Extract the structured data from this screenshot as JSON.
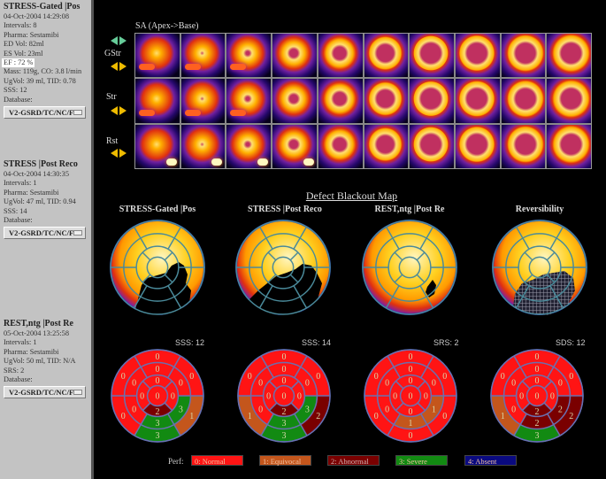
{
  "studies": [
    {
      "title": "STRESS-Gated |Pos",
      "lines": [
        "04-Oct-2004 14:29:08",
        "Intervals: 8",
        "Pharma: Sestamibi",
        "ED Vol:   82ml",
        "ES Vol:   23ml"
      ],
      "ef": "EF  : 72 %",
      "lines2": [
        "Mass: 119g, CO: 3.8 l/min",
        "UgVol:   39 ml,  TID: 0.78",
        "SSS: 12",
        "Database:"
      ],
      "database": "V2-GSRD/TC/NC/F"
    },
    {
      "title": "STRESS |Post Reco",
      "lines": [
        "04-Oct-2004 14:30:35",
        "Intervals: 1",
        "Pharma: Sestamibi",
        "UgVol:   47 ml,  TID: 0.94",
        "SSS: 14",
        "Database:"
      ],
      "database": "V2-GSRD/TC/NC/F"
    },
    {
      "title": "REST,ntg |Post Re",
      "lines": [
        "05-Oct-2004 13:25:58",
        "Intervals: 1",
        "Pharma: Sestamibi",
        "UgVol:   50 ml,  TID: N/A",
        "SRS: 2",
        "Database:"
      ],
      "database": "V2-GSRD/TC/NC/F"
    }
  ],
  "sa": {
    "title": "SA (Apex->Base)",
    "rows": [
      "GStr",
      "Str",
      "Rst"
    ]
  },
  "blackout": {
    "title": "Defect Blackout Map",
    "plots": [
      "STRESS-Gated |Pos",
      "STRESS |Post Reco",
      "REST,ntg |Post Re",
      "Reversibility"
    ]
  },
  "scores": [
    {
      "label": "SSS: 12",
      "apex": 0,
      "apical": [
        0,
        0,
        2,
        0
      ],
      "mid": [
        0,
        0,
        3,
        3,
        0,
        0
      ],
      "basal": [
        0,
        0,
        1,
        3,
        0,
        0
      ]
    },
    {
      "label": "SSS: 14",
      "apex": 0,
      "apical": [
        0,
        0,
        2,
        0
      ],
      "mid": [
        0,
        0,
        3,
        3,
        0,
        0
      ],
      "basal": [
        0,
        0,
        2,
        3,
        1,
        0
      ]
    },
    {
      "label": "SRS: 2",
      "apex": 0,
      "apical": [
        0,
        0,
        0,
        0
      ],
      "mid": [
        0,
        0,
        1,
        1,
        0,
        0
      ],
      "basal": [
        0,
        0,
        0,
        0,
        0,
        0
      ]
    },
    {
      "label": "SDS: 12",
      "apex": 0,
      "apical": [
        0,
        0,
        2,
        0
      ],
      "mid": [
        0,
        0,
        2,
        2,
        0,
        0
      ],
      "basal": [
        0,
        0,
        2,
        3,
        1,
        0
      ]
    }
  ],
  "legend": {
    "label": "Perf:",
    "items": [
      {
        "text": "0: Normal",
        "color": "#ff1414"
      },
      {
        "text": "1: Equivocal",
        "color": "#c4561c"
      },
      {
        "text": "2: Abnormal",
        "color": "#7a0000"
      },
      {
        "text": "3: Severe",
        "color": "#128a12"
      },
      {
        "text": "4: Absent",
        "color": "#0a0a80"
      }
    ]
  }
}
